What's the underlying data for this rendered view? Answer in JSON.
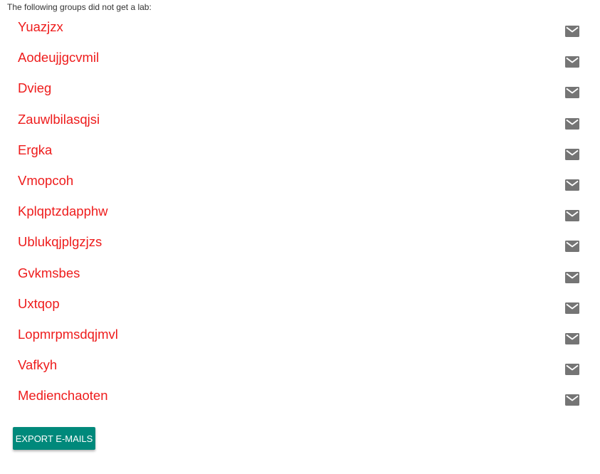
{
  "intro_text": "The following groups did not get a lab:",
  "groups": [
    {
      "name": "Yuazjzx",
      "icon": "mail-icon"
    },
    {
      "name": "Aodeujjgcvmil",
      "icon": "mail-icon"
    },
    {
      "name": "Dvieg",
      "icon": "mail-icon"
    },
    {
      "name": "Zauwlbilasqjsi",
      "icon": "mail-icon"
    },
    {
      "name": "Ergka",
      "icon": "mail-icon"
    },
    {
      "name": "Vmopcoh",
      "icon": "mail-icon"
    },
    {
      "name": "Kplqptzdapphw",
      "icon": "mail-icon"
    },
    {
      "name": "Ublukqjplgzjzs",
      "icon": "mail-icon"
    },
    {
      "name": "Gvkmsbes",
      "icon": "mail-icon"
    },
    {
      "name": "Uxtqop",
      "icon": "mail-icon"
    },
    {
      "name": "Lopmrpmsdqjmvl",
      "icon": "mail-icon"
    },
    {
      "name": "Vafkyh",
      "icon": "mail-icon"
    },
    {
      "name": "Medienchaoten",
      "icon": "mail-icon"
    }
  ],
  "export_button": {
    "label": "EXPORT E-MAILS"
  },
  "colors": {
    "group_name": "#ee1c1c",
    "mail_icon": "#757575",
    "export_button_bg": "#00897b",
    "export_button_text": "#ffffff"
  }
}
